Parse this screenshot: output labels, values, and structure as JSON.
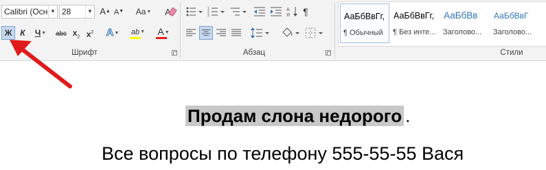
{
  "ribbon": {
    "font_group": {
      "label": "Шрифт",
      "font_name": "Calibri (Осно",
      "font_size": "28",
      "grow_font": "A",
      "shrink_font": "A",
      "change_case": "Aa",
      "bold": "Ж",
      "italic": "К",
      "underline": "Ч",
      "strikethrough": "abc",
      "subscript": "x",
      "superscript": "x",
      "text_effects": "A",
      "highlight_letters": "ab",
      "font_color": "A",
      "highlight_color": "#ffff00",
      "font_color_value": "#e02020"
    },
    "paragraph_group": {
      "label": "Абзац",
      "pilcrow": "¶"
    },
    "styles_group": {
      "label": "Стили",
      "items": [
        {
          "preview": "АаБбВвГг,",
          "name": "¶ Обычный"
        },
        {
          "preview": "АаБбВвГг,",
          "name": "¶ Без инте..."
        },
        {
          "preview": "АаБбВв",
          "name": "Заголово..."
        },
        {
          "preview": "АаБбВвГ",
          "name": "Заголово..."
        }
      ]
    }
  },
  "document": {
    "line1_highlighted": "Продам слона недорого",
    "line1_end": ".",
    "line2": "Все вопросы по телефону 555-55-55 Вася"
  }
}
